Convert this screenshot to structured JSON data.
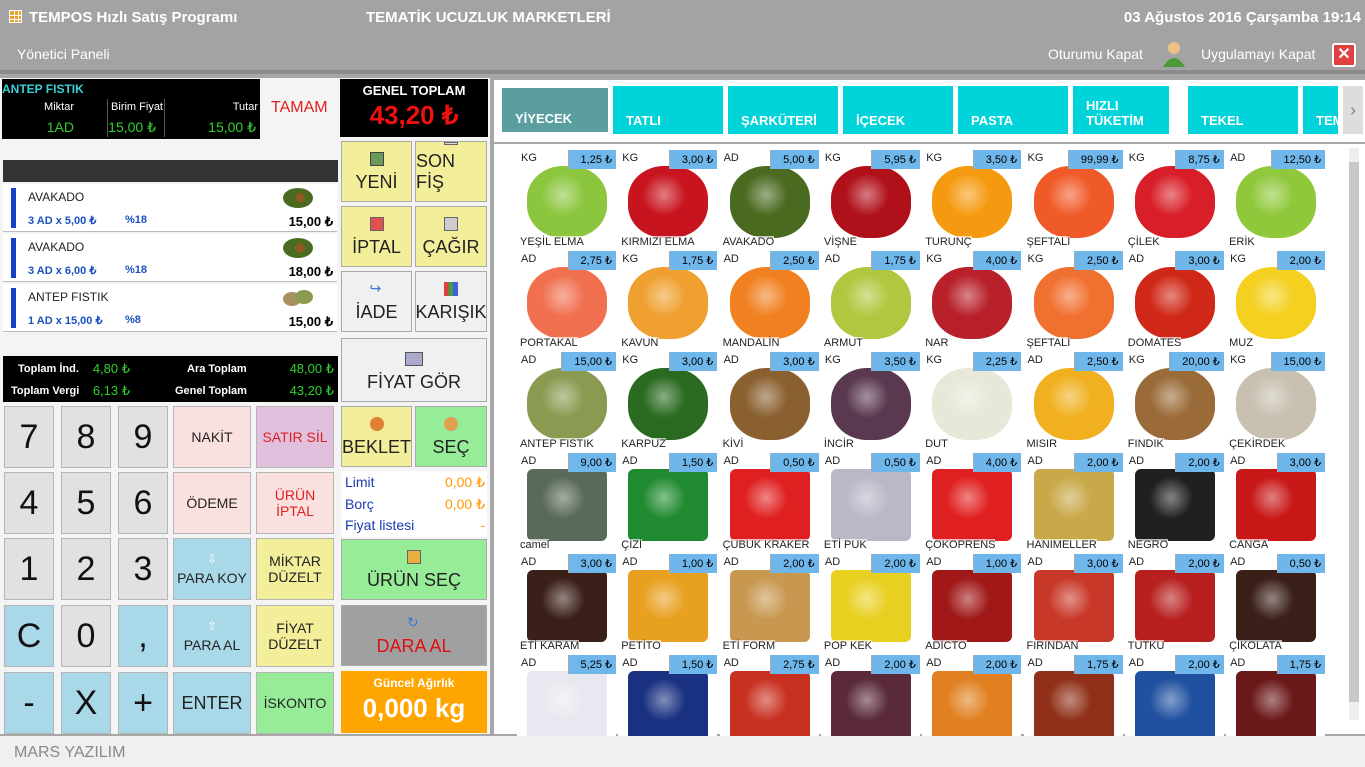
{
  "app": {
    "title": "TEMPOS Hızlı Satış Programı",
    "store": "TEMATİK UCUZLUK MARKETLERİ",
    "datetime": "03 Ağustos 2016 Çarşamba 19:14",
    "admin": "Yönetici Paneli",
    "logout": "Oturumu Kapat",
    "exit": "Uygulamayı Kapat",
    "footer": "MARS YAZILIM"
  },
  "current": {
    "name": "ANTEP FISTIK",
    "h_qty": "Miktar",
    "h_price": "Birim Fiyat",
    "h_total": "Tutar",
    "qty": "1AD",
    "price": "15,00 ₺",
    "total": "15,00 ₺",
    "tamam": "TAMAM"
  },
  "items": [
    {
      "name": "AVAKADO",
      "qty": "3 AD x 5,00 ₺",
      "vat": "%18",
      "total": "15,00 ₺"
    },
    {
      "name": "AVAKADO",
      "qty": "3 AD x 6,00 ₺",
      "vat": "%18",
      "total": "18,00 ₺"
    },
    {
      "name": "ANTEP FISTIK",
      "qty": "1 AD x 15,00 ₺",
      "vat": "%8",
      "total": "15,00 ₺"
    }
  ],
  "totals": {
    "l1": "Toplam İnd.",
    "v1": "4,80 ₺",
    "l2": "Ara Toplam",
    "v2": "48,00 ₺",
    "l3": "Toplam Vergi",
    "v3": "6,13 ₺",
    "l4": "Genel Toplam",
    "v4": "43,20 ₺"
  },
  "keypad": {
    "k7": "7",
    "k8": "8",
    "k9": "9",
    "k4": "4",
    "k5": "5",
    "k6": "6",
    "k1": "1",
    "k2": "2",
    "k3": "3",
    "kc": "C",
    "k0": "0",
    "kcomma": ",",
    "kminus": "-",
    "kx": "X",
    "kplus": "+",
    "nakit": "NAKİT",
    "satirsil": "SATIR SİL",
    "odeme": "ÖDEME",
    "uruniptal": "ÜRÜN İPTAL",
    "parakoy": "PARA KOY",
    "miktar": "MİKTAR DÜZELT",
    "paraal": "PARA AL",
    "fiyat": "FİYAT DÜZELT",
    "enter": "ENTER",
    "iskonto": "İSKONTO"
  },
  "mid": {
    "genel_label": "GENEL TOPLAM",
    "genel_value": "43,20 ₺",
    "yeni": "YENİ",
    "sonfis": "SON FİŞ",
    "iptal": "İPTAL",
    "cagir": "ÇAĞIR",
    "iade": "İADE",
    "karisik": "KARIŞIK",
    "fiyatgor": "FİYAT GÖR",
    "beklet": "BEKLET",
    "sec": "SEÇ",
    "limit": "Limit",
    "limit_v": "0,00 ₺",
    "borc": "Borç",
    "borc_v": "0,00 ₺",
    "fiyatlistesi": "Fiyat listesi",
    "fiyatlistesi_v": "-",
    "urunsec": "ÜRÜN SEÇ",
    "daraal": "DARA AL",
    "agirlik_label": "Güncel Ağırlık",
    "agirlik_value": "0,000 kg"
  },
  "categories": [
    "YİYECEK",
    "TATLI",
    "ŞARKÜTERİ",
    "İÇECEK",
    "PASTA",
    "HIZLI TÜKETİM",
    "TEKEL",
    "TEM"
  ],
  "products": [
    {
      "u": "KG",
      "p": "1,25 ₺",
      "n": "YEŞİL ELMA",
      "c": "#8cc63f"
    },
    {
      "u": "KG",
      "p": "3,00 ₺",
      "n": "KIRMIZI ELMA",
      "c": "#c8141e"
    },
    {
      "u": "AD",
      "p": "5,00 ₺",
      "n": "AVAKADO",
      "c": "#4a6a20"
    },
    {
      "u": "KG",
      "p": "5,95 ₺",
      "n": "VİŞNE",
      "c": "#b0101a"
    },
    {
      "u": "KG",
      "p": "3,50 ₺",
      "n": "TURUNÇ",
      "c": "#f59a10"
    },
    {
      "u": "KG",
      "p": "99,99 ₺",
      "n": "ŞEFTALİ",
      "c": "#f05a28"
    },
    {
      "u": "KG",
      "p": "8,75 ₺",
      "n": "ÇİLEK",
      "c": "#d81e28"
    },
    {
      "u": "AD",
      "p": "12,50 ₺",
      "n": "ERİK",
      "c": "#90c83c"
    },
    {
      "u": "AD",
      "p": "2,75 ₺",
      "n": "PORTAKAL",
      "c": "#f07050"
    },
    {
      "u": "KG",
      "p": "1,75 ₺",
      "n": "KAVUN",
      "c": "#f0a030"
    },
    {
      "u": "AD",
      "p": "2,50 ₺",
      "n": "MANDALİN",
      "c": "#f08020"
    },
    {
      "u": "AD",
      "p": "1,75 ₺",
      "n": "ARMUT",
      "c": "#b0c840"
    },
    {
      "u": "KG",
      "p": "4,00 ₺",
      "n": "NAR",
      "c": "#b8202a"
    },
    {
      "u": "KG",
      "p": "2,50 ₺",
      "n": "ŞEFTALİ",
      "c": "#f07030"
    },
    {
      "u": "AD",
      "p": "3,00 ₺",
      "n": "DOMATES",
      "c": "#d02818"
    },
    {
      "u": "KG",
      "p": "2,00 ₺",
      "n": "MUZ",
      "c": "#f5d020"
    },
    {
      "u": "AD",
      "p": "15,00 ₺",
      "n": "ANTEP FISTIK",
      "c": "#8a9a50"
    },
    {
      "u": "KG",
      "p": "3,00 ₺",
      "n": "KARPUZ",
      "c": "#2a6a20"
    },
    {
      "u": "AD",
      "p": "3,00 ₺",
      "n": "KİVİ",
      "c": "#8a6030"
    },
    {
      "u": "KG",
      "p": "3,50 ₺",
      "n": "İNCİR",
      "c": "#5a3850"
    },
    {
      "u": "KG",
      "p": "2,25 ₺",
      "n": "DUT",
      "c": "#e8e8d8"
    },
    {
      "u": "AD",
      "p": "2,50 ₺",
      "n": "MISIR",
      "c": "#f0b020"
    },
    {
      "u": "KG",
      "p": "20,00 ₺",
      "n": "FINDIK",
      "c": "#9a6a38"
    },
    {
      "u": "KG",
      "p": "15,00 ₺",
      "n": "ÇEKİRDEK",
      "c": "#c8c0b0"
    },
    {
      "u": "AD",
      "p": "9,00 ₺",
      "n": "camel",
      "c": "#5a6a5a"
    },
    {
      "u": "AD",
      "p": "1,50 ₺",
      "n": "ÇİZİ",
      "c": "#208a30"
    },
    {
      "u": "AD",
      "p": "0,50 ₺",
      "n": "ÇUBUK KRAKER",
      "c": "#e02020"
    },
    {
      "u": "AD",
      "p": "0,50 ₺",
      "n": "ETİ PUK",
      "c": "#b8b8c8"
    },
    {
      "u": "AD",
      "p": "4,00 ₺",
      "n": "ÇOKOPRENS",
      "c": "#e02020"
    },
    {
      "u": "AD",
      "p": "2,00 ₺",
      "n": "HANIMELLER",
      "c": "#c8a848"
    },
    {
      "u": "AD",
      "p": "2,00 ₺",
      "n": "NEGRO",
      "c": "#202020"
    },
    {
      "u": "AD",
      "p": "3,00 ₺",
      "n": "CANGA",
      "c": "#c81818"
    },
    {
      "u": "AD",
      "p": "3,00 ₺",
      "n": "ETİ KARAM",
      "c": "#3a2018"
    },
    {
      "u": "AD",
      "p": "1,00 ₺",
      "n": "PETİTO",
      "c": "#e8a020"
    },
    {
      "u": "AD",
      "p": "2,00 ₺",
      "n": "ETİ FORM",
      "c": "#c89850"
    },
    {
      "u": "AD",
      "p": "2,00 ₺",
      "n": "POP KEK",
      "c": "#e8d020"
    },
    {
      "u": "AD",
      "p": "1,00 ₺",
      "n": "ADİCTO",
      "c": "#a01818"
    },
    {
      "u": "AD",
      "p": "3,00 ₺",
      "n": "FIRINDAN",
      "c": "#c83828"
    },
    {
      "u": "AD",
      "p": "2,00 ₺",
      "n": "TUTKU",
      "c": "#b82020"
    },
    {
      "u": "AD",
      "p": "0,50 ₺",
      "n": "ÇİKOLATA",
      "c": "#3a2018"
    },
    {
      "u": "AD",
      "p": "5,25 ₺",
      "n": "",
      "c": "#e8e8f0"
    },
    {
      "u": "AD",
      "p": "1,50 ₺",
      "n": "",
      "c": "#1a3080"
    },
    {
      "u": "AD",
      "p": "2,75 ₺",
      "n": "",
      "c": "#c83020"
    },
    {
      "u": "AD",
      "p": "2,00 ₺",
      "n": "",
      "c": "#5a2a38"
    },
    {
      "u": "AD",
      "p": "2,00 ₺",
      "n": "",
      "c": "#e08020"
    },
    {
      "u": "AD",
      "p": "1,75 ₺",
      "n": "",
      "c": "#903018"
    },
    {
      "u": "AD",
      "p": "2,00 ₺",
      "n": "",
      "c": "#2050a0"
    },
    {
      "u": "AD",
      "p": "1,75 ₺",
      "n": "",
      "c": "#6a1818"
    }
  ]
}
